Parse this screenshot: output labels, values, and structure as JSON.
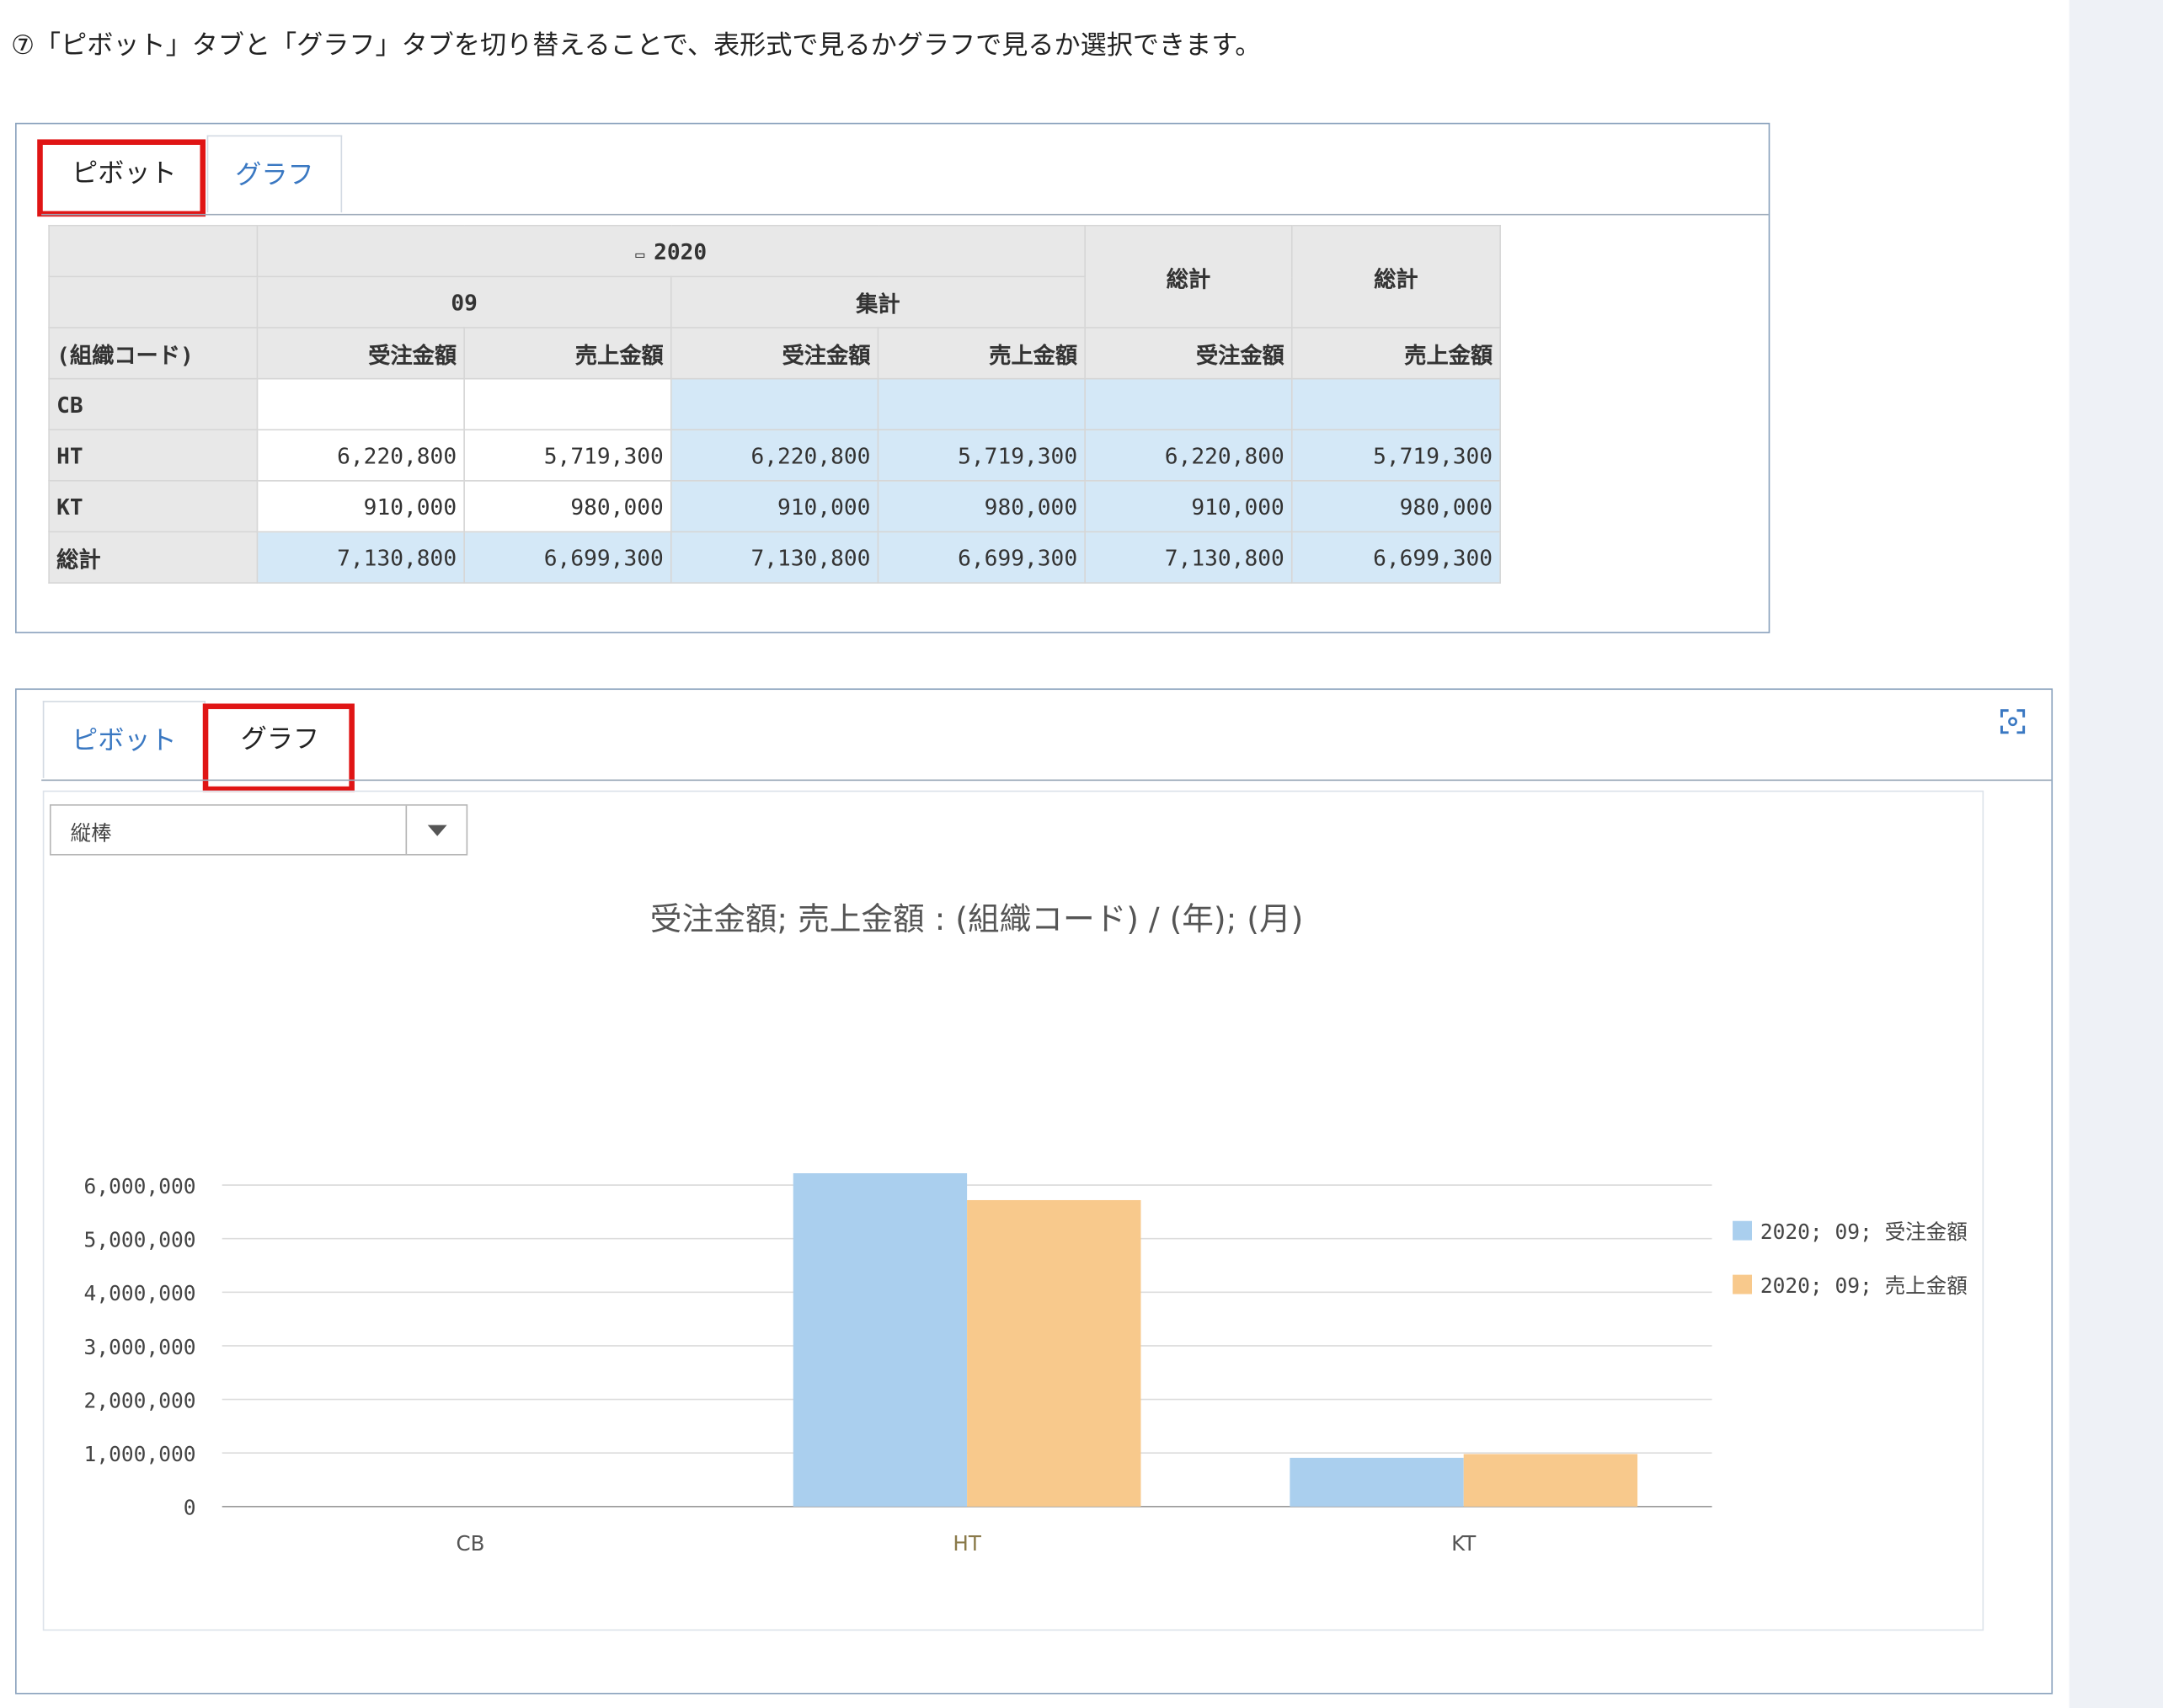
{
  "instruction": "⑦「ピボット」タブと「グラフ」タブを切り替えることで、表形式で見るかグラフで見るか選択できます。",
  "tabs": {
    "pivot": "ピボット",
    "graph": "グラフ"
  },
  "pivot": {
    "year": "2020",
    "month": "09",
    "subtotal": "集計",
    "total1": "総計",
    "total2": "総計",
    "row_header": "(組織コード)",
    "col_labels": [
      "受注金額",
      "売上金額",
      "受注金額",
      "売上金額",
      "受注金額",
      "売上金額"
    ],
    "rows": [
      {
        "label": "CB",
        "cells": [
          "",
          "",
          "",
          "",
          "",
          ""
        ]
      },
      {
        "label": "HT",
        "cells": [
          "6,220,800",
          "5,719,300",
          "6,220,800",
          "5,719,300",
          "6,220,800",
          "5,719,300"
        ]
      },
      {
        "label": "KT",
        "cells": [
          "910,000",
          "980,000",
          "910,000",
          "980,000",
          "910,000",
          "980,000"
        ]
      },
      {
        "label": "総計",
        "cells": [
          "7,130,800",
          "6,699,300",
          "7,130,800",
          "6,699,300",
          "7,130,800",
          "6,699,300"
        ]
      }
    ]
  },
  "select": {
    "value": "縦棒"
  },
  "chart_data": {
    "type": "bar",
    "title": "受注金額; 売上金額 : (組織コード) / (年); (月)",
    "categories": [
      "CB",
      "HT",
      "KT"
    ],
    "series": [
      {
        "name": "2020; 09; 受注金額",
        "values": [
          0,
          6220800,
          910000
        ],
        "color": "#aacfee"
      },
      {
        "name": "2020; 09; 売上金額",
        "values": [
          0,
          5719300,
          980000
        ],
        "color": "#f8c98c"
      }
    ],
    "yticks": [
      "0",
      "1,000,000",
      "2,000,000",
      "3,000,000",
      "4,000,000",
      "5,000,000",
      "6,000,000"
    ],
    "ylim": [
      0,
      6000000
    ],
    "grid": true,
    "legend": "right",
    "xlabel": "",
    "ylabel": ""
  }
}
